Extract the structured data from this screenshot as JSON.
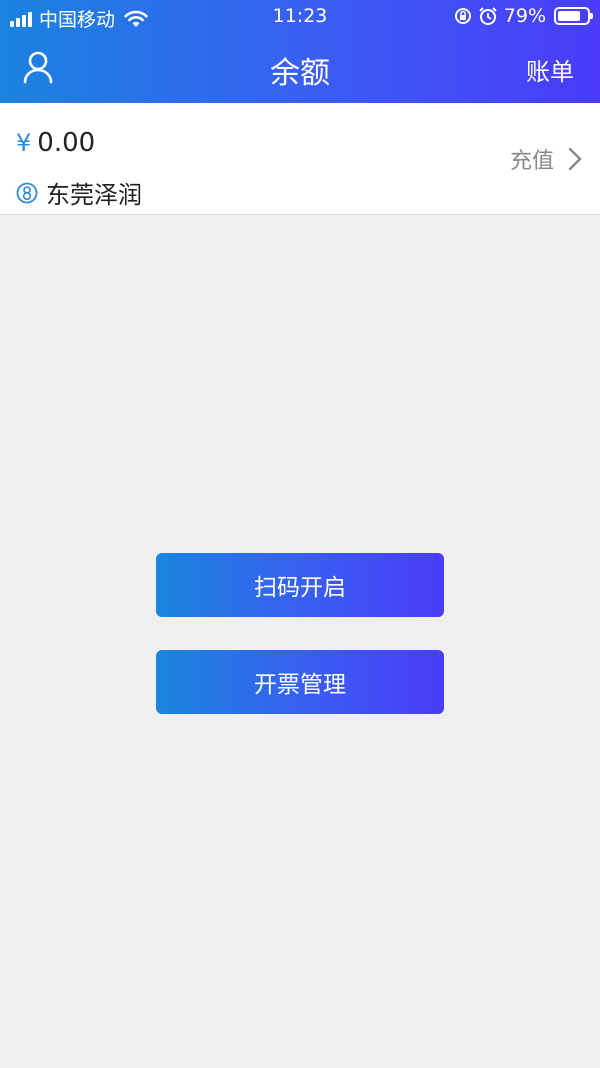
{
  "status_bar": {
    "carrier": "中国移动",
    "time": "11:23",
    "battery_percent": "79%",
    "battery_level": 0.79
  },
  "navbar": {
    "user_icon": "user-icon",
    "title": "余额",
    "right_label": "账单"
  },
  "balance": {
    "currency_symbol": "¥",
    "amount": "0.00",
    "company_icon": "company-logo-icon",
    "company": "东莞泽润",
    "recharge_label": "充值"
  },
  "actions": {
    "scan_label": "扫码开启",
    "invoice_label": "开票管理"
  },
  "colors": {
    "gradient_start": "#1b83e0",
    "gradient_end": "#4a3cf9",
    "accent_blue": "#2a8bd8",
    "background": "#efefef"
  }
}
